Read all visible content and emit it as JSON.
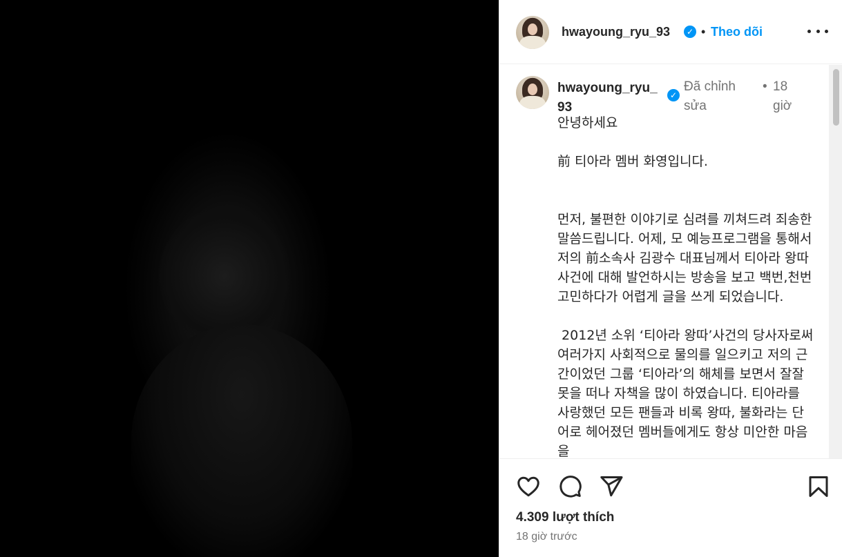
{
  "post": {
    "username": "hwayoung_ryu_93",
    "follow_label": "Theo dõi",
    "dot": "•",
    "caption": {
      "username": "hwayoung_ryu_93",
      "edited_label": "Đã chỉnh sửa",
      "time": "18 giờ",
      "paragraphs": [
        "안녕하세요",
        "前 티아라 멤버 화영입니다.",
        "먼저, 불편한 이야기로 심려를 끼쳐드려 죄송한 말씀드립니다. 어제, 모 예능프로그램을 통해서 저의 前소속사 김광수 대표님께서 티아라 왕따 사건에 대해 발언하시는 방송을 보고 백번,천번 고민하다가 어렵게 글을 쓰게 되었습니다.",
        " 2012년 소위 ‘티아라 왕따’사건의 당사자로써 여러가지 사회적으로 물의를 일으키고 저의 근간이었던 그룹 ‘티아라’의 해체를 보면서 잘잘못을 떠나 자책을 많이 하였습니다. 티아라를 사랑했던 모든 팬들과 비록 왕따, 불화라는 단어로 헤어졌던 멤버들에게도 항상 미안한 마음을"
      ]
    },
    "likes": "4.309 lượt thích",
    "posted_ago": "18 giờ trước"
  },
  "icons": {
    "verified": "verified-badge-icon",
    "more": "more-options-icon",
    "like": "heart-icon",
    "comment": "comment-bubble-icon",
    "share": "send-icon",
    "save": "bookmark-icon"
  },
  "colors": {
    "accent": "#0095f6",
    "text": "#262626",
    "muted": "#737373",
    "border": "#efefef"
  }
}
